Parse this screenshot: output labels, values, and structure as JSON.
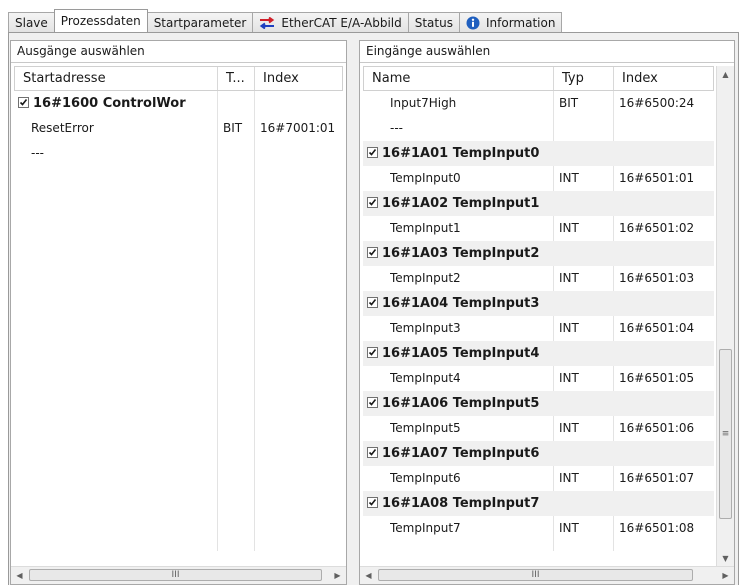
{
  "tabs": [
    {
      "label": "Slave",
      "active": false
    },
    {
      "label": "Prozessdaten",
      "active": true
    },
    {
      "label": "Startparameter",
      "active": false
    },
    {
      "label": "EtherCAT E/A-Abbild",
      "active": false,
      "icon": "swap-arrows-icon"
    },
    {
      "label": "Status",
      "active": false
    },
    {
      "label": "Information",
      "active": false,
      "icon": "info-icon"
    }
  ],
  "outputs": {
    "title": "Ausgänge auswählen",
    "columns": [
      "Startadresse",
      "T...",
      "Index"
    ],
    "rows": [
      {
        "group": true,
        "checked": true,
        "name": "16#1600 ControlWor",
        "type": "",
        "index": ""
      },
      {
        "group": false,
        "name": "ResetError",
        "type": "BIT",
        "index": "16#7001:01"
      },
      {
        "group": false,
        "name": "---",
        "type": "",
        "index": ""
      }
    ],
    "scroll_symbol": "III"
  },
  "inputs": {
    "title": "Eingänge auswählen",
    "columns": [
      "Name",
      "Typ",
      "Index"
    ],
    "rows": [
      {
        "group": false,
        "name": "Input7High",
        "type": "BIT",
        "index": "16#6500:24"
      },
      {
        "group": false,
        "name": "---",
        "type": "",
        "index": ""
      },
      {
        "group": true,
        "checked": true,
        "name": "16#1A01 TempInput0",
        "type": "",
        "index": ""
      },
      {
        "group": false,
        "name": "TempInput0",
        "type": "INT",
        "index": "16#6501:01"
      },
      {
        "group": true,
        "checked": true,
        "name": "16#1A02 TempInput1",
        "type": "",
        "index": ""
      },
      {
        "group": false,
        "name": "TempInput1",
        "type": "INT",
        "index": "16#6501:02"
      },
      {
        "group": true,
        "checked": true,
        "name": "16#1A03 TempInput2",
        "type": "",
        "index": ""
      },
      {
        "group": false,
        "name": "TempInput2",
        "type": "INT",
        "index": "16#6501:03"
      },
      {
        "group": true,
        "checked": true,
        "name": "16#1A04 TempInput3",
        "type": "",
        "index": ""
      },
      {
        "group": false,
        "name": "TempInput3",
        "type": "INT",
        "index": "16#6501:04"
      },
      {
        "group": true,
        "checked": true,
        "name": "16#1A05 TempInput4",
        "type": "",
        "index": ""
      },
      {
        "group": false,
        "name": "TempInput4",
        "type": "INT",
        "index": "16#6501:05"
      },
      {
        "group": true,
        "checked": true,
        "name": "16#1A06 TempInput5",
        "type": "",
        "index": ""
      },
      {
        "group": false,
        "name": "TempInput5",
        "type": "INT",
        "index": "16#6501:06"
      },
      {
        "group": true,
        "checked": true,
        "name": "16#1A07 TempInput6",
        "type": "",
        "index": ""
      },
      {
        "group": false,
        "name": "TempInput6",
        "type": "INT",
        "index": "16#6501:07"
      },
      {
        "group": true,
        "checked": true,
        "name": "16#1A08 TempInput7",
        "type": "",
        "index": ""
      },
      {
        "group": false,
        "name": "TempInput7",
        "type": "INT",
        "index": "16#6501:08"
      }
    ],
    "scroll_symbol": "III",
    "vscroll_symbol": "≡"
  },
  "colors": {
    "group_row_bg": "#f0f0f0",
    "info_icon": "#1f5fbf",
    "swap_icon_red": "#d0202a",
    "swap_icon_blue": "#1f3fbf"
  }
}
